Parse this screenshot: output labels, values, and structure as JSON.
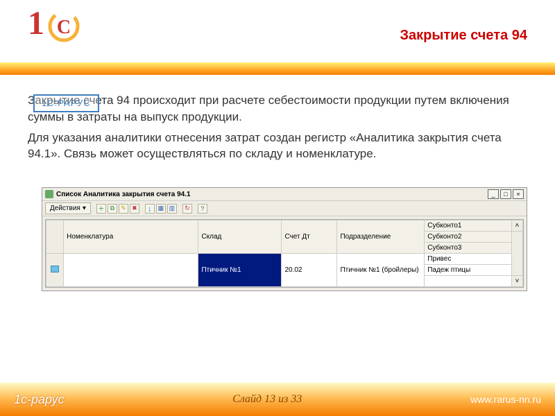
{
  "slide": {
    "title": "Закрытие счета 94",
    "watermark": "1С:РАРУС",
    "paragraph1": "Закрытие счета 94 происходит при расчете себестоимости продукции путем включения суммы в затраты на выпуск продукции.",
    "paragraph2": "Для указания аналитики отнесения затрат создан регистр «Аналитика закрытия счета 94.1». Связь может осуществляться по складу и номенклатуре."
  },
  "appwindow": {
    "title": "Список Аналитика закрытия счета 94.1",
    "actions_label": "Действия",
    "columns": {
      "nomenklatura": "Номенклатура",
      "sklad": "Склад",
      "schet_dt": "Счет Дт",
      "podrazdelenie": "Подразделение",
      "sub1": "Субконто1",
      "sub2": "Субконто2",
      "sub3": "Субконто3"
    },
    "row": {
      "nomenklatura": "",
      "sklad": "Птичник №1",
      "schet_dt": "20.02",
      "podrazdelenie": "Птичник №1 (бройлеры)",
      "sub1": "Привес",
      "sub2": "Падеж птицы",
      "sub3": ""
    }
  },
  "footer": {
    "brand": "1с-рарус",
    "slide_counter": "Слайд 13 из 33",
    "url": "www.rarus-nn.ru"
  }
}
